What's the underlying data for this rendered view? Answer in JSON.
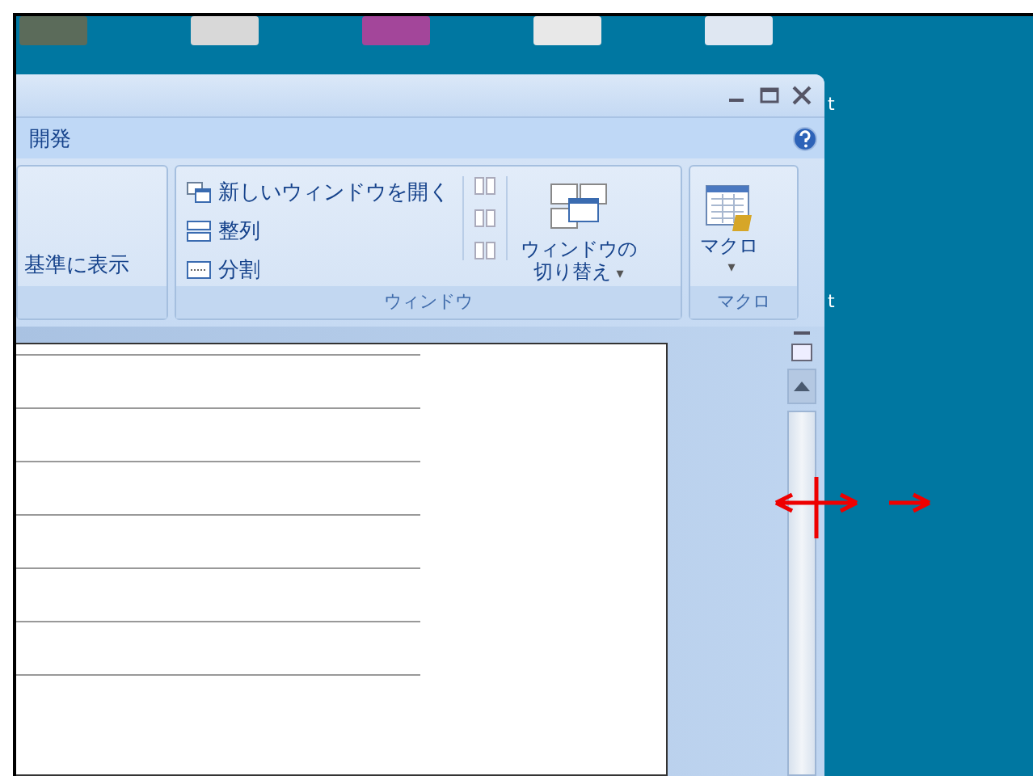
{
  "desktop": {
    "labels": [
      "t",
      "t"
    ]
  },
  "window": {
    "tabs": [
      {
        "label": "開発",
        "selected": true
      }
    ]
  },
  "ribbon": {
    "groups": [
      {
        "items": [
          {
            "kind": "text",
            "label": "基準に表示"
          }
        ]
      },
      {
        "label": "ウィンドウ",
        "items": [
          {
            "kind": "small-list",
            "buttons": [
              {
                "label": "新しいウィンドウを開く"
              },
              {
                "label": "整列"
              },
              {
                "label": "分割"
              }
            ]
          },
          {
            "kind": "icon-column"
          },
          {
            "kind": "large",
            "lines": [
              "ウィンドウの",
              "切り替え"
            ],
            "caret": "▾"
          }
        ]
      },
      {
        "label": "マクロ",
        "items": [
          {
            "kind": "large",
            "lines": [
              "マクロ"
            ],
            "caret": "▾"
          }
        ]
      }
    ]
  }
}
